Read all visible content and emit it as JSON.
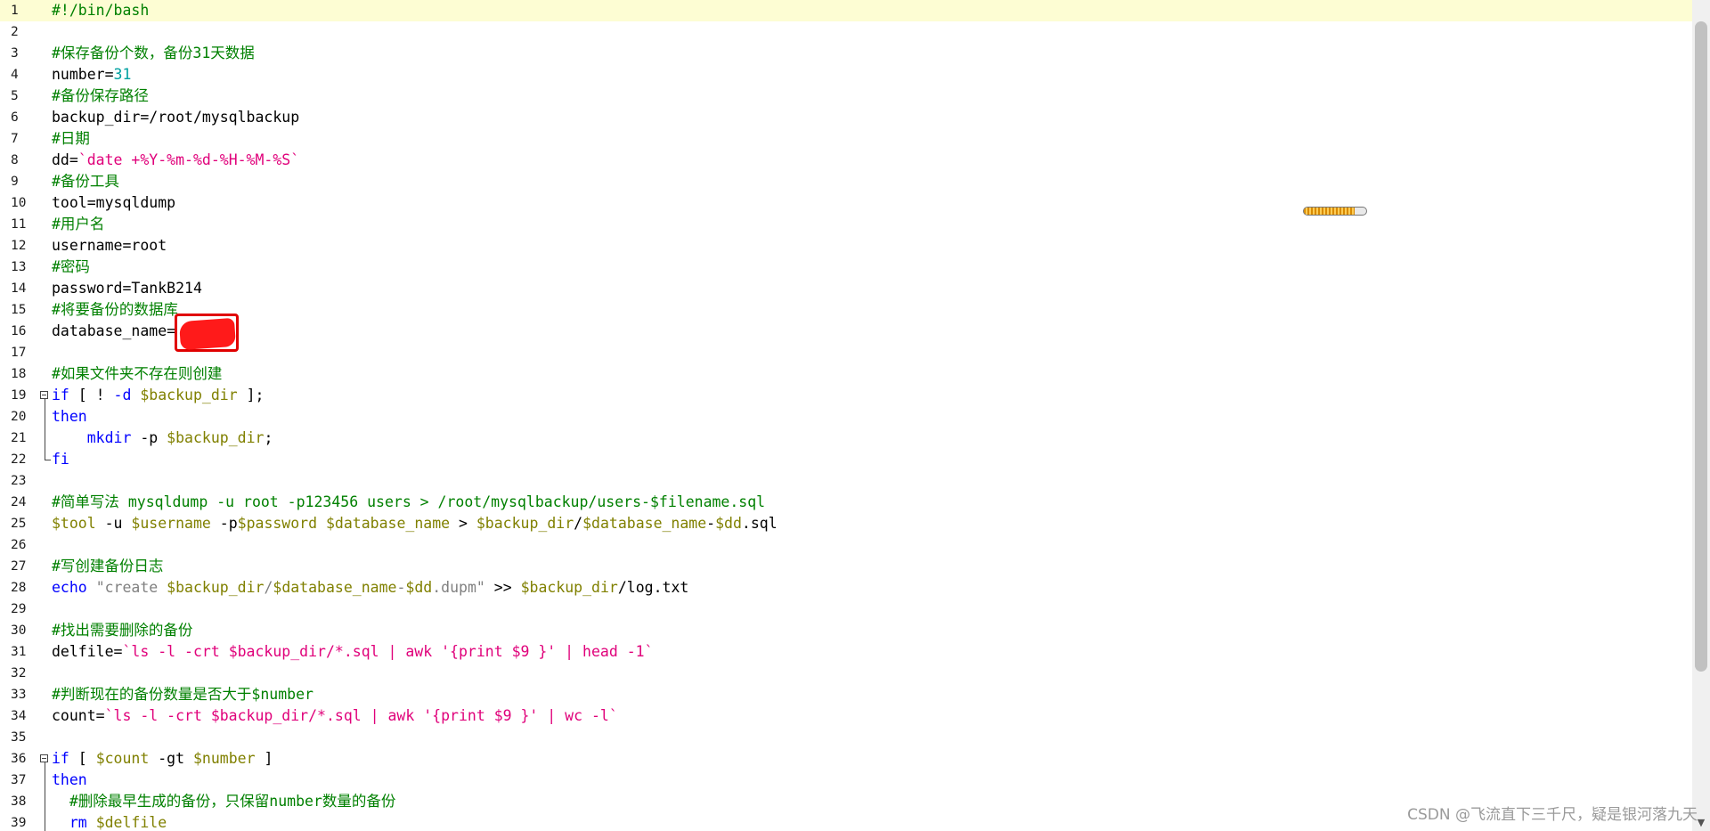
{
  "editor": {
    "lines": [
      {
        "n": "1",
        "segs": [
          [
            "comment",
            "#!/bin/bash"
          ]
        ]
      },
      {
        "n": "2",
        "segs": []
      },
      {
        "n": "3",
        "segs": [
          [
            "comment",
            "#保存备份个数，备份31天数据"
          ]
        ]
      },
      {
        "n": "4",
        "segs": [
          [
            "plain",
            "number="
          ],
          [
            "num",
            "31"
          ]
        ]
      },
      {
        "n": "5",
        "segs": [
          [
            "comment",
            "#备份保存路径"
          ]
        ]
      },
      {
        "n": "6",
        "segs": [
          [
            "plain",
            "backup_dir=/root/mysqlbackup"
          ]
        ]
      },
      {
        "n": "7",
        "segs": [
          [
            "comment",
            "#日期"
          ]
        ]
      },
      {
        "n": "8",
        "segs": [
          [
            "plain",
            "dd="
          ],
          [
            "bt",
            "`date +%Y-%m-%d-%H-%M-%S`"
          ]
        ]
      },
      {
        "n": "9",
        "segs": [
          [
            "comment",
            "#备份工具"
          ]
        ]
      },
      {
        "n": "10",
        "segs": [
          [
            "plain",
            "tool=mysqldump"
          ]
        ]
      },
      {
        "n": "11",
        "segs": [
          [
            "comment",
            "#用户名"
          ]
        ]
      },
      {
        "n": "12",
        "segs": [
          [
            "plain",
            "username=root"
          ]
        ]
      },
      {
        "n": "13",
        "segs": [
          [
            "comment",
            "#密码"
          ]
        ]
      },
      {
        "n": "14",
        "segs": [
          [
            "plain",
            "password=TankB214"
          ]
        ]
      },
      {
        "n": "15",
        "segs": [
          [
            "comment",
            "#将要备份的数据库"
          ]
        ]
      },
      {
        "n": "16",
        "segs": [
          [
            "plain",
            "database_name="
          ]
        ]
      },
      {
        "n": "17",
        "segs": []
      },
      {
        "n": "18",
        "segs": [
          [
            "comment",
            "#如果文件夹不存在则创建"
          ]
        ]
      },
      {
        "n": "19",
        "segs": [
          [
            "kw",
            "if"
          ],
          [
            "plain",
            " [ ! "
          ],
          [
            "kw",
            "-d"
          ],
          [
            "plain",
            " "
          ],
          [
            "var",
            "$backup_dir"
          ],
          [
            "plain",
            " ];"
          ]
        ]
      },
      {
        "n": "20",
        "segs": [
          [
            "kw",
            "then"
          ]
        ]
      },
      {
        "n": "21",
        "segs": [
          [
            "plain",
            "    "
          ],
          [
            "kw",
            "mkdir"
          ],
          [
            "plain",
            " -p "
          ],
          [
            "var",
            "$backup_dir"
          ],
          [
            "plain",
            ";"
          ]
        ]
      },
      {
        "n": "22",
        "segs": [
          [
            "kw",
            "fi"
          ]
        ]
      },
      {
        "n": "23",
        "segs": []
      },
      {
        "n": "24",
        "segs": [
          [
            "comment",
            "#简单写法 mysqldump -u root -p123456 users > /root/mysqlbackup/users-$filename.sql"
          ]
        ]
      },
      {
        "n": "25",
        "segs": [
          [
            "var",
            "$tool"
          ],
          [
            "plain",
            " -u "
          ],
          [
            "var",
            "$username"
          ],
          [
            "plain",
            " -p"
          ],
          [
            "var",
            "$password"
          ],
          [
            "plain",
            " "
          ],
          [
            "var",
            "$database_name"
          ],
          [
            "plain",
            " > "
          ],
          [
            "var",
            "$backup_dir"
          ],
          [
            "plain",
            "/"
          ],
          [
            "var",
            "$database_name"
          ],
          [
            "plain",
            "-"
          ],
          [
            "var",
            "$dd"
          ],
          [
            "plain",
            ".sql"
          ]
        ]
      },
      {
        "n": "26",
        "segs": []
      },
      {
        "n": "27",
        "segs": [
          [
            "comment",
            "#写创建备份日志"
          ]
        ]
      },
      {
        "n": "28",
        "segs": [
          [
            "kw",
            "echo"
          ],
          [
            "plain",
            " "
          ],
          [
            "dquote",
            "\"create "
          ],
          [
            "var",
            "$backup_dir"
          ],
          [
            "dquote",
            "/"
          ],
          [
            "var",
            "$database_name"
          ],
          [
            "dquote",
            "-"
          ],
          [
            "var",
            "$dd"
          ],
          [
            "dquote",
            ".dupm\""
          ],
          [
            "plain",
            " >> "
          ],
          [
            "var",
            "$backup_dir"
          ],
          [
            "plain",
            "/log.txt"
          ]
        ]
      },
      {
        "n": "29",
        "segs": []
      },
      {
        "n": "30",
        "segs": [
          [
            "comment",
            "#找出需要删除的备份"
          ]
        ]
      },
      {
        "n": "31",
        "segs": [
          [
            "plain",
            "delfile="
          ],
          [
            "bt",
            "`ls -l -crt $backup_dir/*.sql | awk '{print $9 }' | head -1`"
          ]
        ]
      },
      {
        "n": "32",
        "segs": []
      },
      {
        "n": "33",
        "segs": [
          [
            "comment",
            "#判断现在的备份数量是否大于$number"
          ]
        ]
      },
      {
        "n": "34",
        "segs": [
          [
            "plain",
            "count="
          ],
          [
            "bt",
            "`ls -l -crt $backup_dir/*.sql | awk '{print $9 }' | wc -l`"
          ]
        ]
      },
      {
        "n": "35",
        "segs": []
      },
      {
        "n": "36",
        "segs": [
          [
            "kw",
            "if"
          ],
          [
            "plain",
            " [ "
          ],
          [
            "var",
            "$count"
          ],
          [
            "plain",
            " -gt "
          ],
          [
            "var",
            "$number"
          ],
          [
            "plain",
            " ]"
          ]
        ]
      },
      {
        "n": "37",
        "segs": [
          [
            "kw",
            "then"
          ]
        ]
      },
      {
        "n": "38",
        "segs": [
          [
            "plain",
            "  "
          ],
          [
            "comment",
            "#删除最早生成的备份，只保留number数量的备份"
          ]
        ]
      },
      {
        "n": "39",
        "segs": [
          [
            "plain",
            "  "
          ],
          [
            "kw",
            "rm"
          ],
          [
            "plain",
            " "
          ],
          [
            "var",
            "$delfile"
          ]
        ]
      }
    ]
  },
  "progress": {
    "value": 0.82
  },
  "watermark": "CSDN @飞流直下三千尺，疑是银河落九天",
  "scrollbar": {
    "down_icon": "chevron-down-icon"
  },
  "colors": {
    "comment": "#008000",
    "keyword": "#0000ff",
    "variable": "#808000",
    "backtick": "#e0007a",
    "number": "#00a0a0",
    "current_line": "#fdfdd3"
  }
}
